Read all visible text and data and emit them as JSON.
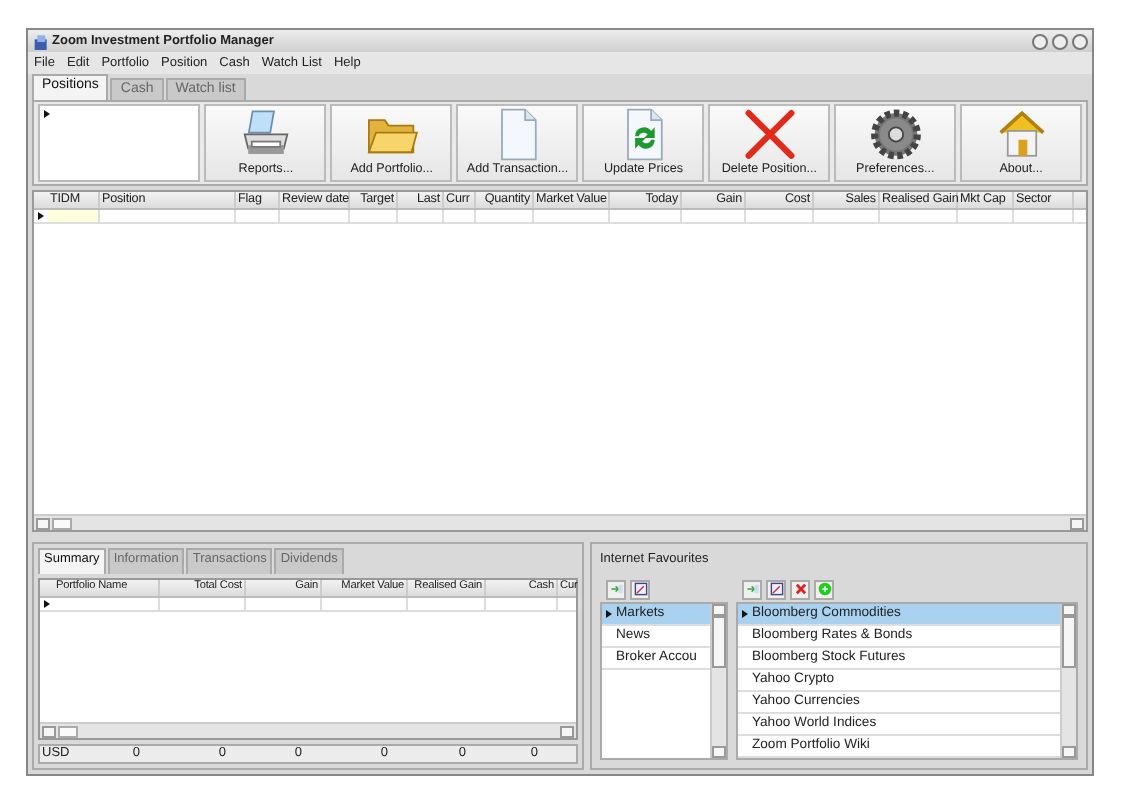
{
  "window": {
    "title": "Zoom Investment Portfolio Manager"
  },
  "menu": [
    "File",
    "Edit",
    "Portfolio",
    "Position",
    "Cash",
    "Watch List",
    "Help"
  ],
  "tabs": [
    {
      "label": "Positions",
      "selected": true
    },
    {
      "label": "Cash",
      "selected": false
    },
    {
      "label": "Watch list",
      "selected": false
    }
  ],
  "toolbar": [
    {
      "label": "Reports...",
      "kind": "printer"
    },
    {
      "label": "Add Portfolio...",
      "kind": "folder"
    },
    {
      "label": "Add Transaction...",
      "kind": "document"
    },
    {
      "label": "Update Prices",
      "kind": "refresh"
    },
    {
      "label": "Delete Position...",
      "kind": "delete"
    },
    {
      "label": "Preferences...",
      "kind": "gear"
    },
    {
      "label": "About...",
      "kind": "house"
    }
  ],
  "positions_table": {
    "columns": [
      "TIDM",
      "Position",
      "Flag",
      "Review date",
      "Target",
      "Last",
      "Curr",
      "Quantity",
      "Market Value",
      "Today",
      "Gain",
      "Cost",
      "Sales",
      "Realised Gain",
      "Mkt Cap",
      "Sector"
    ]
  },
  "summary_tabs": [
    {
      "label": "Summary",
      "selected": true
    },
    {
      "label": "Information",
      "selected": false
    },
    {
      "label": "Transactions",
      "selected": false
    },
    {
      "label": "Dividends",
      "selected": false
    }
  ],
  "summary_table": {
    "columns": [
      "Portfolio Name",
      "Total Cost",
      "Gain",
      "Market Value",
      "Realised Gain",
      "Cash",
      "Cur"
    ],
    "totals": [
      "USD",
      "0",
      "0",
      "0",
      "0",
      "0",
      "0"
    ]
  },
  "favourites": {
    "title": "Internet Favourites",
    "categories": [
      {
        "label": "Markets",
        "selected": true
      },
      {
        "label": "News",
        "selected": false
      },
      {
        "label": "Broker Accou",
        "selected": false
      }
    ],
    "links": [
      {
        "label": "Bloomberg Commodities",
        "selected": true
      },
      {
        "label": "Bloomberg Rates & Bonds",
        "selected": false
      },
      {
        "label": "Bloomberg Stock Futures",
        "selected": false
      },
      {
        "label": "Yahoo Crypto",
        "selected": false
      },
      {
        "label": "Yahoo Currencies",
        "selected": false
      },
      {
        "label": "Yahoo World Indices",
        "selected": false
      },
      {
        "label": "Zoom Portfolio Wiki",
        "selected": false
      }
    ]
  }
}
